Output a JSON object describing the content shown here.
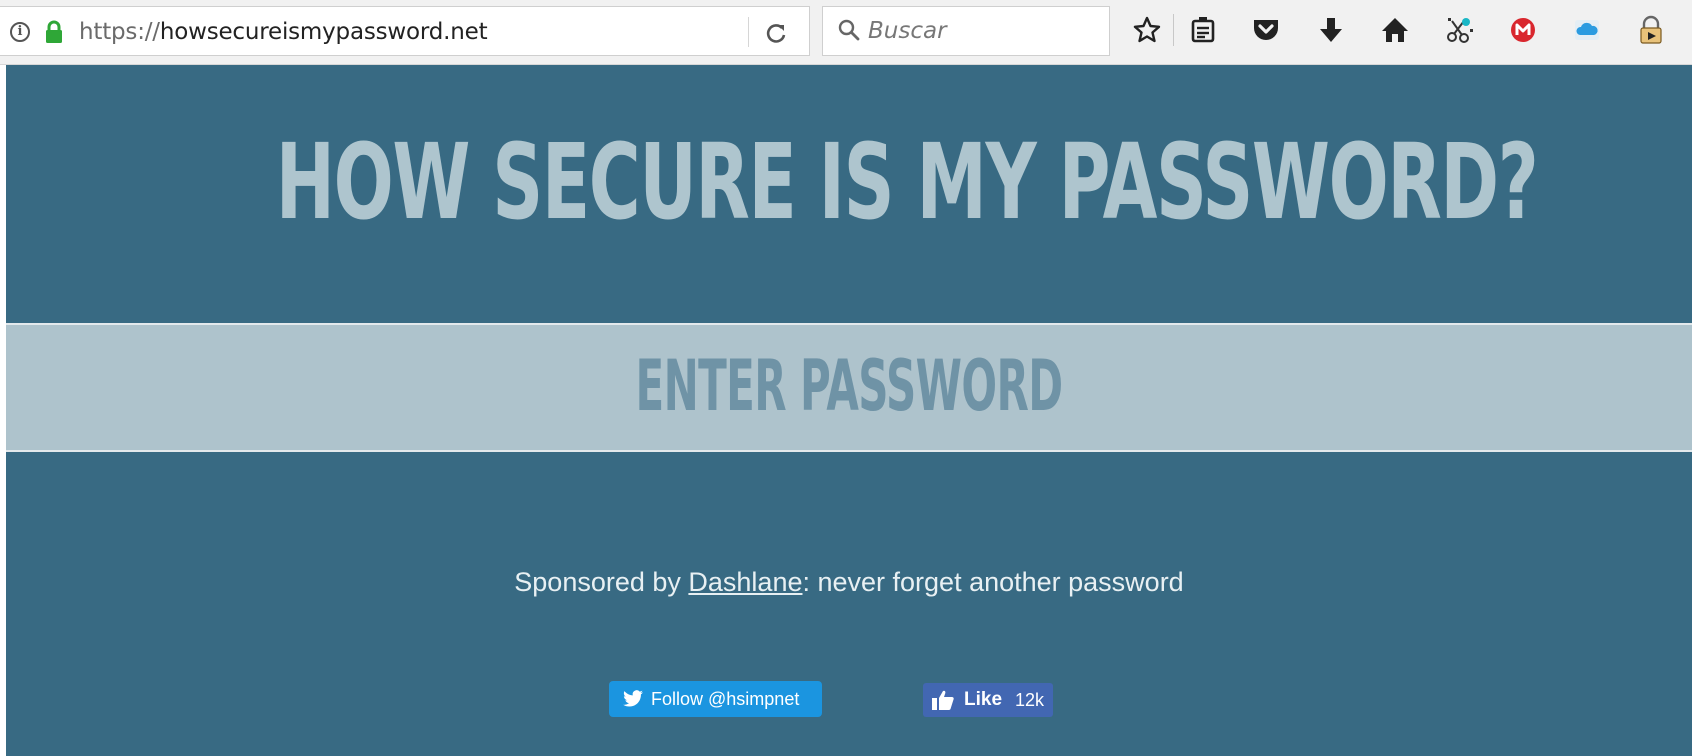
{
  "browser": {
    "url_scheme": "https://",
    "url_host": "howsecureismypassword.net",
    "search_placeholder": "Buscar",
    "toolbar_icons": [
      "bookmark-star-icon",
      "reader-view-icon",
      "pocket-icon",
      "download-icon",
      "home-icon",
      "screenshot-extension-icon",
      "mega-extension-icon",
      "cloud-extension-icon",
      "lock-extension-icon"
    ]
  },
  "page": {
    "title": "HOW SECURE IS MY PASSWORD?",
    "password_placeholder": "ENTER PASSWORD",
    "sponsor_prefix": "Sponsored by ",
    "sponsor_link": "Dashlane",
    "sponsor_suffix": ": never forget another password",
    "twitter_label": "Follow @hsimpnet",
    "facebook_label": "Like",
    "facebook_count": "12k"
  },
  "colors": {
    "page_bg": "#386a83",
    "title": "#aec5ce",
    "band_bg": "#aec3cc",
    "placeholder": "#6f93a6",
    "twitter": "#1b95e0",
    "facebook": "#4267b2"
  }
}
